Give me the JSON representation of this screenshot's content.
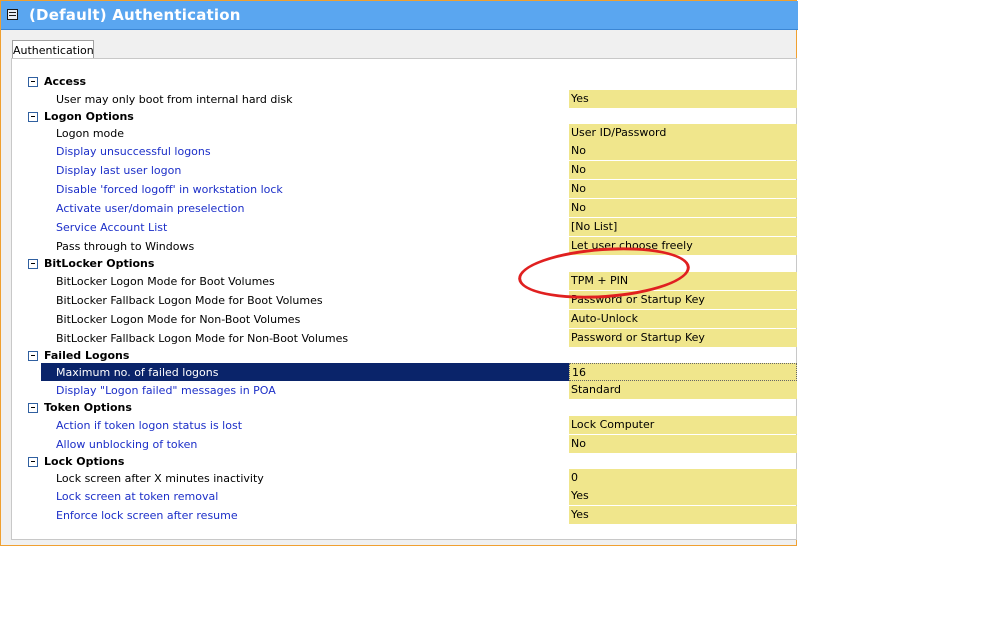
{
  "window": {
    "title": "(Default) Authentication"
  },
  "tabs": [
    {
      "label": "Authentication"
    }
  ],
  "categories": {
    "access": {
      "label": "Access",
      "items": [
        {
          "label": "User may only boot from internal hard disk",
          "value": "Yes"
        }
      ]
    },
    "logon_options": {
      "label": "Logon Options",
      "items": [
        {
          "label": "Logon mode",
          "value": "User ID/Password"
        },
        {
          "label": "Display unsuccessful logons",
          "value": "No"
        },
        {
          "label": "Display last user logon",
          "value": "No"
        },
        {
          "label": "Disable 'forced logoff' in workstation lock",
          "value": "No"
        },
        {
          "label": "Activate user/domain preselection",
          "value": "No"
        },
        {
          "label": "Service Account List",
          "value": "[No List]"
        },
        {
          "label": "Pass through to Windows",
          "value": "Let user choose freely"
        }
      ]
    },
    "bitlocker_options": {
      "label": "BitLocker Options",
      "items": [
        {
          "label": "BitLocker Logon Mode for Boot Volumes",
          "value": "TPM + PIN"
        },
        {
          "label": "BitLocker Fallback Logon Mode for Boot Volumes",
          "value": "Password or Startup Key"
        },
        {
          "label": "BitLocker Logon Mode for Non-Boot Volumes",
          "value": "Auto-Unlock"
        },
        {
          "label": "BitLocker Fallback Logon Mode for Non-Boot Volumes",
          "value": "Password or Startup Key"
        }
      ]
    },
    "failed_logons": {
      "label": "Failed Logons",
      "items": [
        {
          "label": "Maximum no. of failed logons",
          "value": "16"
        },
        {
          "label": "Display \"Logon failed\" messages in POA",
          "value": "Standard"
        }
      ]
    },
    "token_options": {
      "label": "Token Options",
      "items": [
        {
          "label": "Action if token logon status is lost",
          "value": "Lock Computer"
        },
        {
          "label": "Allow unblocking of token",
          "value": "No"
        }
      ]
    },
    "lock_options": {
      "label": "Lock Options",
      "items": [
        {
          "label": "Lock screen after X minutes inactivity",
          "value": "0"
        },
        {
          "label": "Lock screen at token removal",
          "value": "Yes"
        },
        {
          "label": "Enforce lock screen after resume",
          "value": "Yes"
        }
      ]
    }
  },
  "colors": {
    "titlebar": "#5aa6f0",
    "value_background": "#f0e68c",
    "link_text": "#1c2fc8",
    "selection": "#0a246a",
    "annotation_circle": "#e02020"
  }
}
